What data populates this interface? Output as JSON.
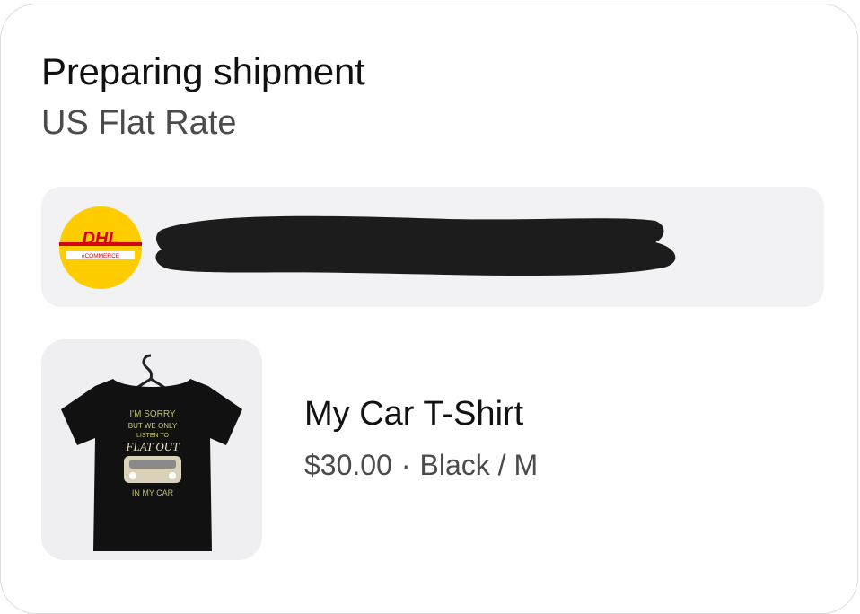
{
  "shipment": {
    "status_title": "Preparing shipment",
    "shipping_method": "US Flat Rate"
  },
  "carrier": {
    "logo_text": "DHL",
    "logo_subtext": "eCOMMERCE",
    "tracking_redacted": true,
    "brand_colors": {
      "yellow": "#ffcc00",
      "red": "#d40511"
    }
  },
  "product": {
    "name": "My Car T-Shirt",
    "price": "$30.00",
    "separator": "·",
    "variant": "Black / M",
    "shirt_print": [
      "I'M SORRY",
      "BUT WE ONLY",
      "LISTEN TO",
      "FLAT OUT",
      "IN MY CAR"
    ]
  },
  "colors": {
    "card_border": "#dcdcdc",
    "panel_bg": "#f2f2f4",
    "text_primary": "#111111",
    "text_secondary": "#4b4b4b"
  }
}
